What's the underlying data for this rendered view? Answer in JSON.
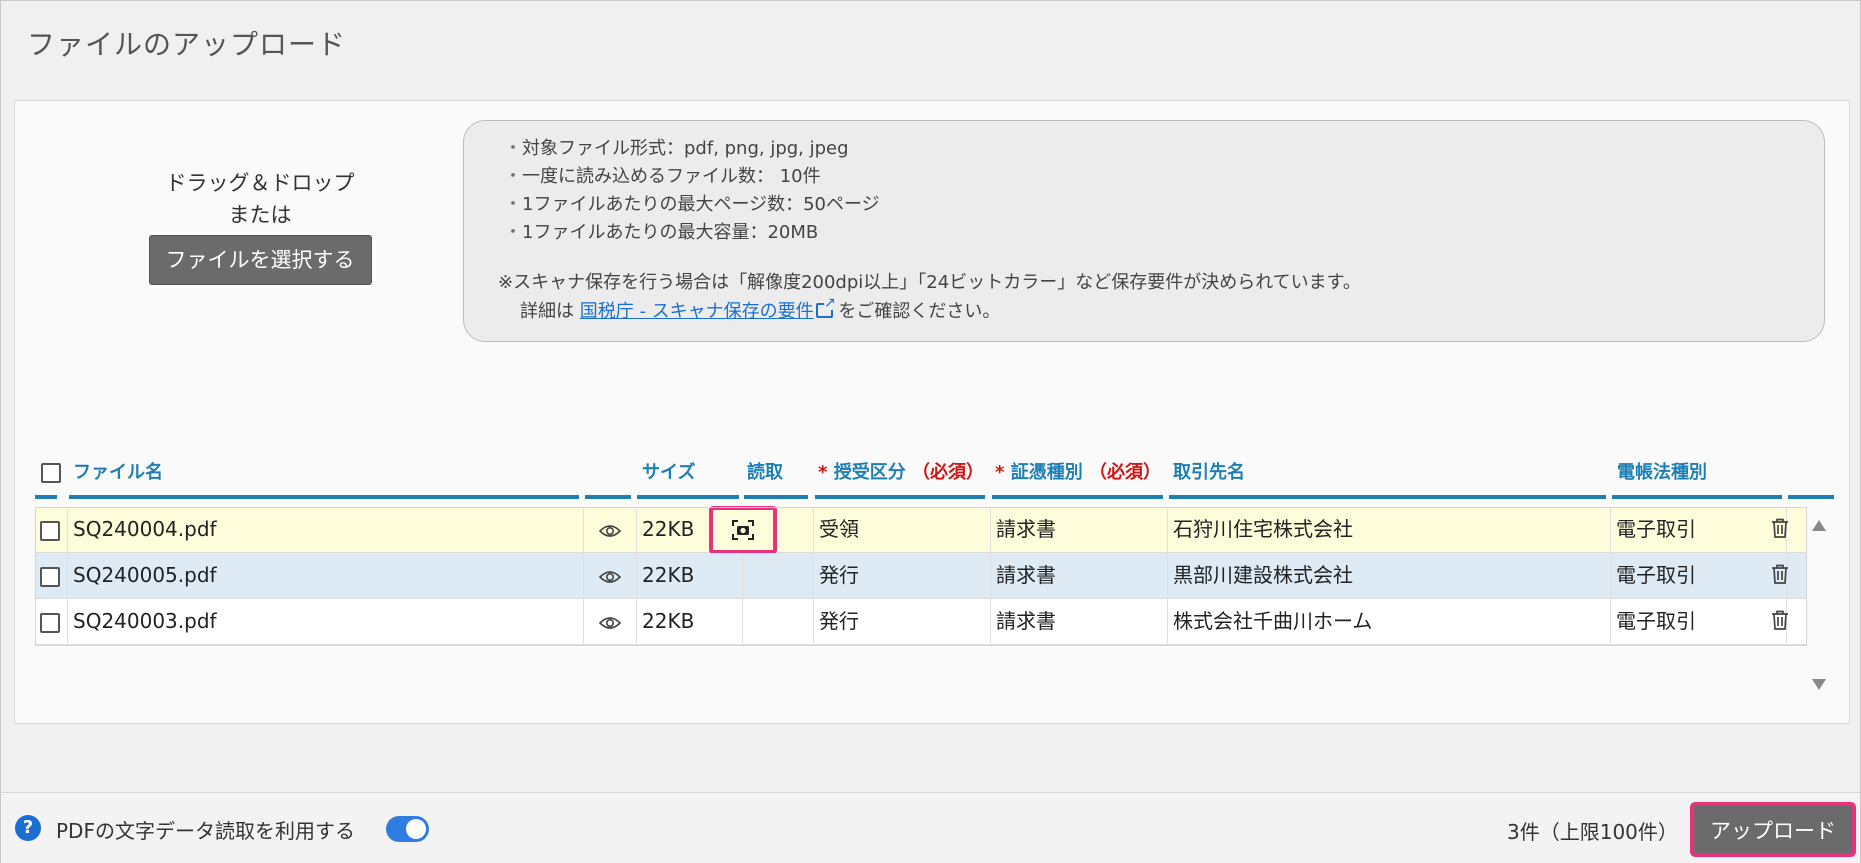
{
  "page": {
    "title": "ファイルのアップロード"
  },
  "dropzone": {
    "line1": "ドラッグ＆ドロップ",
    "line2": "または",
    "select_button": "ファイルを選択する"
  },
  "info": {
    "rules": [
      "対象ファイル形式：pdf, png, jpg, jpeg",
      "一度に読み込めるファイル数： 10件",
      "1ファイルあたりの最大ページ数：50ページ",
      "1ファイルあたりの最大容量：20MB"
    ],
    "note": "※スキャナ保存を行う場合は「解像度200dpi以上」「24ビットカラー」など保存要件が決められています。",
    "detail_prefix": "詳細は",
    "detail_link": "国税庁 - スキャナ保存の要件",
    "detail_suffix": "をご確認ください。"
  },
  "table": {
    "headers": {
      "filename": "ファイル名",
      "size": "サイズ",
      "scan": "読取",
      "direction": "授受区分",
      "doc_type": "証憑種別",
      "partner": "取引先名",
      "law_type": "電帳法種別",
      "required_mark": "*",
      "required_label": "（必須）"
    },
    "rows": [
      {
        "filename": "SQ240004.pdf",
        "size": "22KB",
        "direction": "受領",
        "doc_type": "請求書",
        "partner": "石狩川住宅株式会社",
        "law_type": "電子取引"
      },
      {
        "filename": "SQ240005.pdf",
        "size": "22KB",
        "direction": "発行",
        "doc_type": "請求書",
        "partner": "黒部川建設株式会社",
        "law_type": "電子取引"
      },
      {
        "filename": "SQ240003.pdf",
        "size": "22KB",
        "direction": "発行",
        "doc_type": "請求書",
        "partner": "株式会社千曲川ホーム",
        "law_type": "電子取引"
      }
    ]
  },
  "footer": {
    "help_icon": "?",
    "pdf_text_option": "PDFの文字データ読取を利用する",
    "pdf_text_enabled": true,
    "count": "3件（上限100件）",
    "upload_button": "アップロード"
  },
  "colors": {
    "accent": "#1f7fb3",
    "highlight": "#e6347c",
    "required": "#d01515"
  }
}
